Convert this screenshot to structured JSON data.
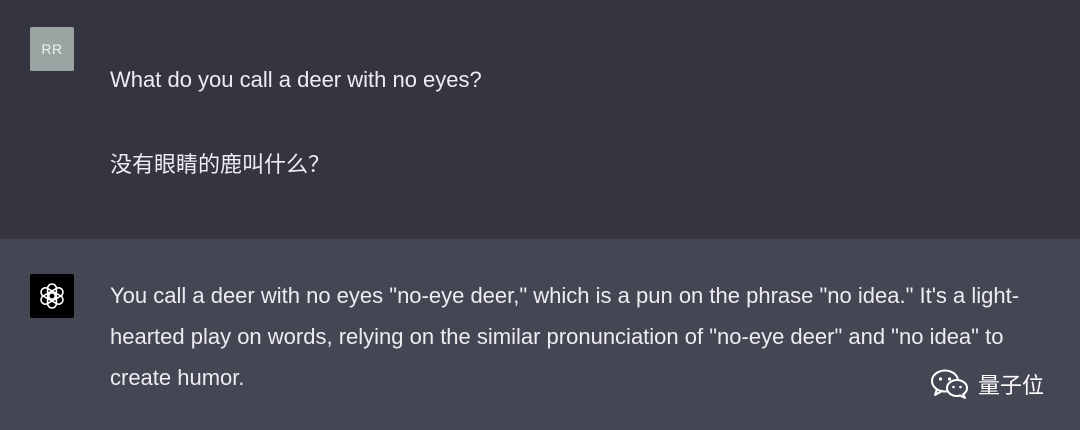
{
  "user_message": {
    "avatar_initials": "RR",
    "lines": [
      "What do you call a deer with no eyes?",
      "没有眼睛的鹿叫什么？"
    ]
  },
  "assistant_message": {
    "avatar_icon": "openai-logo-icon",
    "text": "You call a deer with no eyes \"no-eye deer,\" which is a pun on the phrase \"no idea.\" It's a light-hearted play on words, relying on the similar pronunciation of \"no-eye deer\" and \"no idea\" to create humor."
  },
  "watermark": {
    "icon": "wechat-icon",
    "label": "量子位"
  },
  "colors": {
    "user_bg": "#343541",
    "assistant_bg": "#444654",
    "text": "#ececf1",
    "user_avatar_bg": "#9aa5a3",
    "bot_avatar_bg": "#000000"
  }
}
